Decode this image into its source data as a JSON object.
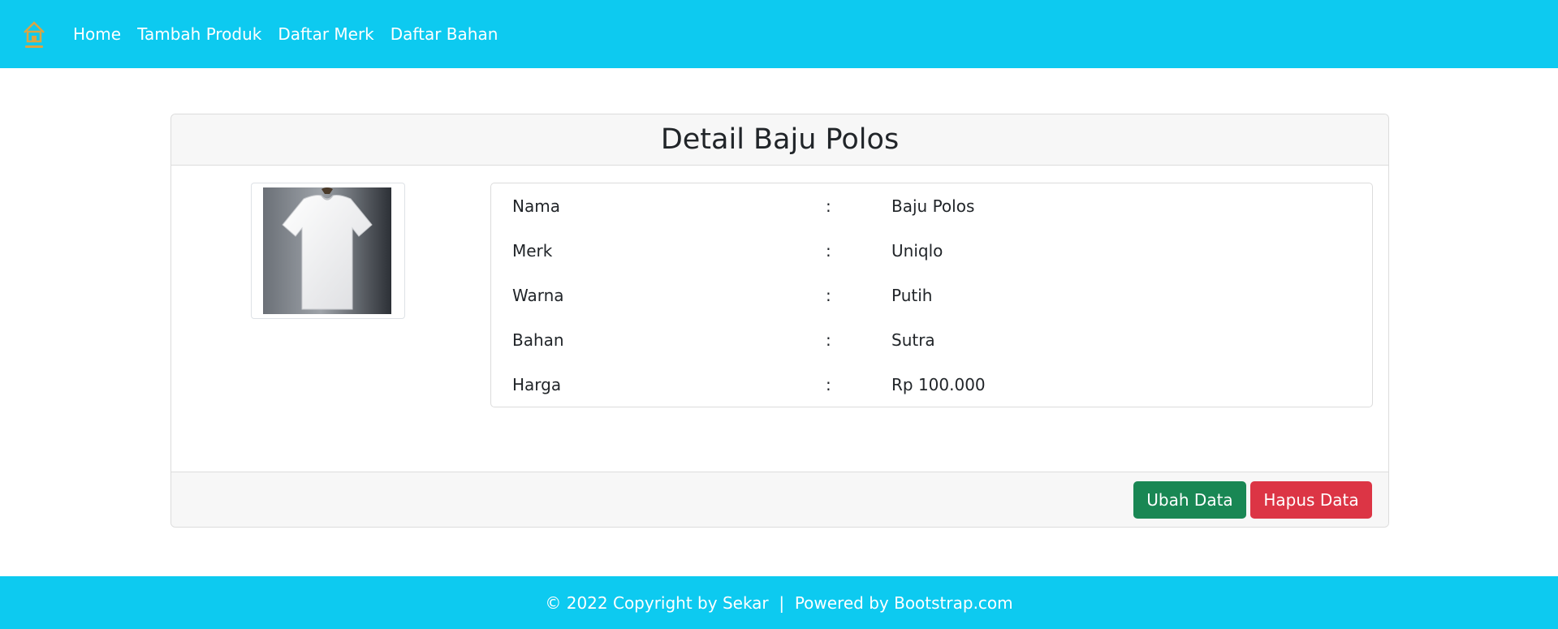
{
  "navbar": {
    "brand_icon": "home-icon",
    "brand_color": "#d9a544",
    "background": "#0dcaf0",
    "links": [
      "Home",
      "Tambah Produk",
      "Daftar Merk",
      "Daftar Bahan"
    ]
  },
  "card": {
    "title": "Detail Baju Polos",
    "image_alt": "Baju Polos",
    "rows": [
      {
        "label": "Nama",
        "colon": ":",
        "value": "Baju Polos"
      },
      {
        "label": "Merk",
        "colon": ":",
        "value": "Uniqlo"
      },
      {
        "label": "Warna",
        "colon": ":",
        "value": "Putih"
      },
      {
        "label": "Bahan",
        "colon": ":",
        "value": "Sutra"
      },
      {
        "label": "Harga",
        "colon": ":",
        "value": "Rp 100.000"
      }
    ],
    "buttons": {
      "edit": "Ubah Data",
      "delete": "Hapus Data"
    }
  },
  "colors": {
    "edit_button": "#198754",
    "delete_button": "#dc3545"
  },
  "footer": {
    "text": "© 2022 Copyright by Sekar  |  Powered by Bootstrap.com"
  }
}
